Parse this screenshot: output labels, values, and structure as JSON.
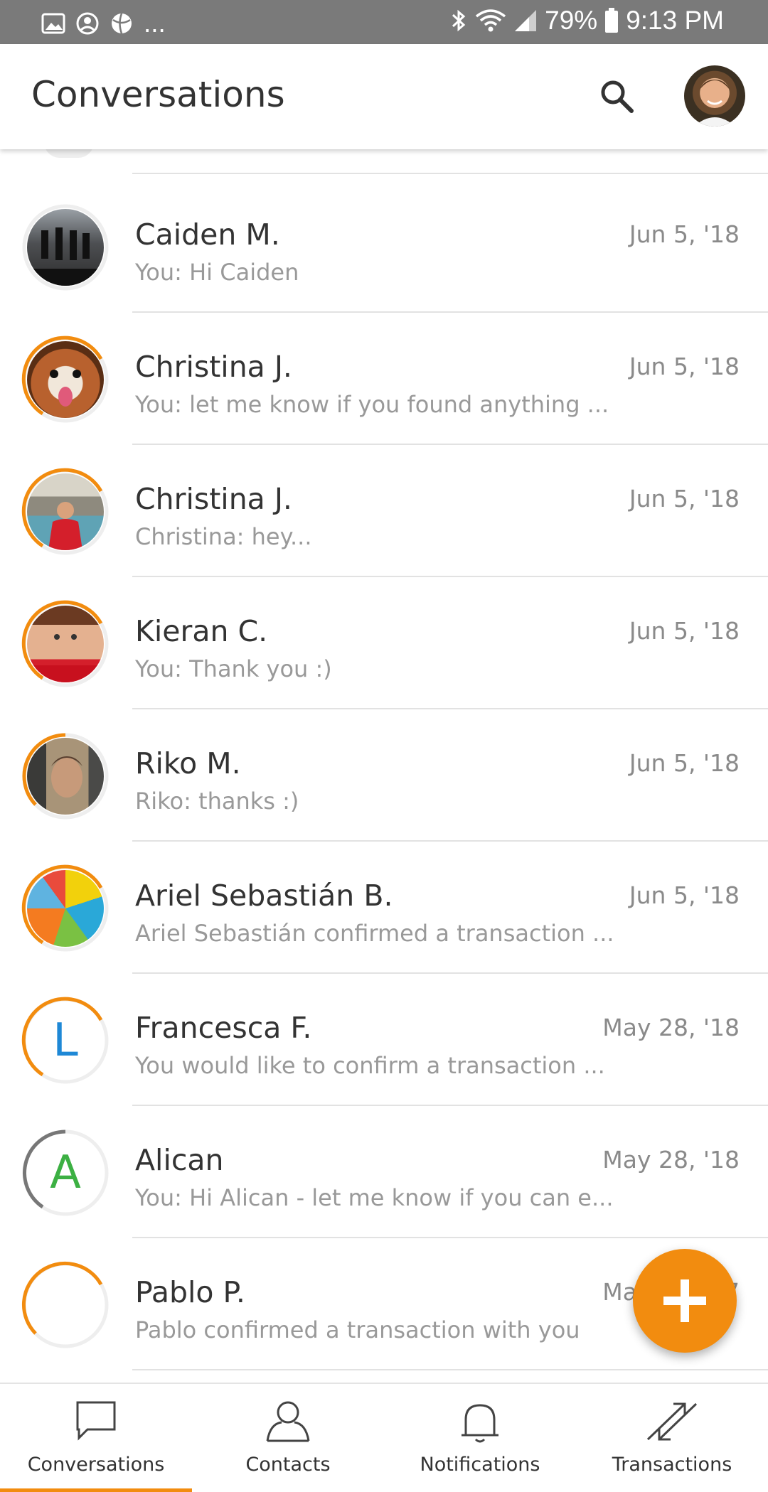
{
  "status_bar": {
    "battery": "79%",
    "time": "9:13 PM",
    "left_icons": [
      "image-icon",
      "account-circle-icon",
      "ball-icon"
    ],
    "overflow": "...",
    "right_icons": [
      "bluetooth-icon",
      "wifi-icon",
      "signal-icon",
      "battery-icon"
    ]
  },
  "app_bar": {
    "title": "Conversations",
    "actions": [
      "search-icon",
      "profile-avatar"
    ]
  },
  "accent_color": "#f28c0f",
  "conversations": [
    {
      "name": "Caiden M.",
      "preview": "You: Hi Caiden",
      "date": "Jun 5, '18"
    },
    {
      "name": "Christina J.",
      "preview": "You: let me know if you found anything ...",
      "date": "Jun 5, '18"
    },
    {
      "name": "Christina J.",
      "preview": "Christina: hey...",
      "date": "Jun 5, '18"
    },
    {
      "name": "Kieran C.",
      "preview": "You: Thank you :)",
      "date": "Jun 5, '18"
    },
    {
      "name": "Riko M.",
      "preview": "Riko: thanks :)",
      "date": "Jun 5, '18"
    },
    {
      "name": "Ariel Sebastián B.",
      "preview": "Ariel Sebastián confirmed a transaction ...",
      "date": "Jun 5, '18"
    },
    {
      "name": "Francesca F.",
      "preview": "You would like to confirm a transaction ...",
      "date": "May 28, '18",
      "avatar_letter": "L",
      "letter_color": "#1e88d6"
    },
    {
      "name": "Alican",
      "preview": "You: Hi Alican - let me know if you can e...",
      "date": "May 28, '18",
      "avatar_letter": "A",
      "letter_color": "#3cb043"
    },
    {
      "name": "Pablo P.",
      "preview": "Pablo confirmed a transaction with you",
      "date": "Ma",
      "date_tail": "7"
    }
  ],
  "fab": {
    "icon": "plus-icon"
  },
  "bottom_nav": {
    "tabs": [
      {
        "label": "Conversations",
        "icon": "chat-bubble-icon",
        "active": true
      },
      {
        "label": "Contacts",
        "icon": "person-icon",
        "active": false
      },
      {
        "label": "Notifications",
        "icon": "bell-icon",
        "active": false
      },
      {
        "label": "Transactions",
        "icon": "exchange-arrows-icon",
        "active": false
      }
    ]
  }
}
